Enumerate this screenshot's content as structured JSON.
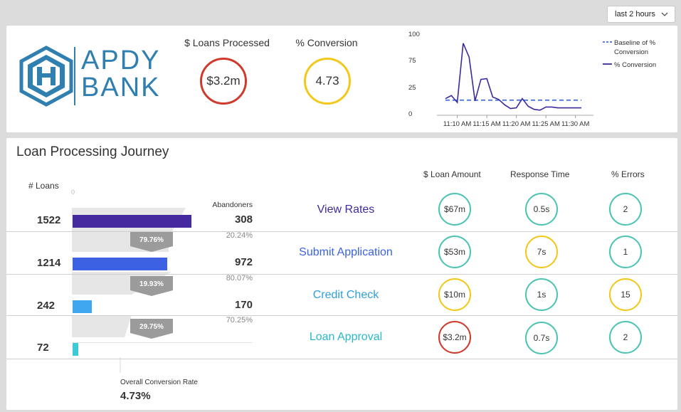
{
  "time_range": {
    "selected": "last 2 hours"
  },
  "logo": {
    "line1": "APDY",
    "line2": "BANK"
  },
  "kpis": {
    "loans_processed": {
      "label": "$ Loans Processed",
      "value": "$3.2m",
      "status": "#d03a2c"
    },
    "conversion": {
      "label": "% Conversion",
      "value": "4.73",
      "status": "#f2c81a"
    }
  },
  "chart_data": {
    "type": "line",
    "x": [
      "11:08",
      "11:09",
      "11:10",
      "11:11",
      "11:12",
      "11:13",
      "11:14",
      "11:15",
      "11:16",
      "11:17",
      "11:18",
      "11:19",
      "11:20",
      "11:21",
      "11:22",
      "11:23",
      "11:24",
      "11:25",
      "11:26",
      "11:27",
      "11:28",
      "11:29",
      "11:30",
      "11:31"
    ],
    "x_tick_labels": [
      "11:10 AM",
      "11:15 AM",
      "11:20 AM",
      "11:25 AM",
      "11:30 AM"
    ],
    "y_tick_labels": [
      "100",
      "75",
      "25",
      "0"
    ],
    "ylim": [
      0,
      100
    ],
    "series": [
      {
        "name": "% Conversion",
        "values": [
          18,
          22,
          13,
          90,
          72,
          15,
          43,
          44,
          20,
          17,
          10,
          5,
          6,
          18,
          8,
          4,
          3,
          7,
          7,
          6,
          6,
          6,
          6,
          6
        ],
        "style": "solid",
        "color": "#3b2a9c"
      },
      {
        "name": "Baseline of % Conversion",
        "values": [
          16,
          16,
          16,
          16,
          16,
          16,
          16,
          16,
          16,
          16,
          16,
          16,
          16,
          16,
          16,
          16,
          16,
          16,
          16,
          16,
          16,
          16,
          16,
          16
        ],
        "style": "dashed",
        "color": "#3f6fd8"
      }
    ],
    "legend": [
      "Baseline of % Conversion",
      "% Conversion"
    ],
    "legend_position": "right"
  },
  "journey": {
    "title": "Loan Processing Journey",
    "loans_header": "# Loans",
    "axis_zero": "0",
    "abandoners_header": "Abandoners",
    "col_amount": "$ Loan Amount",
    "col_response": "Response Time",
    "col_errors": "% Errors",
    "stages": [
      {
        "name": "View Rates",
        "name_color": "#3f2a9e",
        "loans": "1522",
        "loans_value": 1522,
        "bar_color": "#44299f",
        "abandoners": "308",
        "abandon_pct": "20.24%",
        "conversion": "79.76%",
        "amount": "$67m",
        "amount_status": "#4dc4b3",
        "response": "0.5s",
        "response_status": "#4dc4b3",
        "errors": "2",
        "errors_status": "#4dc4b3"
      },
      {
        "name": "Submit Application",
        "name_color": "#3b62e0",
        "loans": "1214",
        "loans_value": 1214,
        "bar_color": "#3d61e3",
        "abandoners": "972",
        "abandon_pct": "80.07%",
        "conversion": "19.93%",
        "amount": "$53m",
        "amount_status": "#4dc4b3",
        "response": "7s",
        "response_status": "#f2c81a",
        "errors": "1",
        "errors_status": "#4dc4b3"
      },
      {
        "name": "Credit Check",
        "name_color": "#2e9fe0",
        "loans": "242",
        "loans_value": 242,
        "bar_color": "#3fa6f0",
        "abandoners": "170",
        "abandon_pct": "70.25%",
        "conversion": "29.75%",
        "amount": "$10m",
        "amount_status": "#f2c81a",
        "response": "1s",
        "response_status": "#4dc4b3",
        "errors": "15",
        "errors_status": "#f2c81a"
      },
      {
        "name": "Loan Approval",
        "name_color": "#2ab8c8",
        "loans": "72",
        "loans_value": 72,
        "bar_color": "#3ccbd4",
        "abandoners": "",
        "abandon_pct": "",
        "conversion": "",
        "amount": "$3.2m",
        "amount_status": "#d03a2c",
        "response": "0.7s",
        "response_status": "#4dc4b3",
        "errors": "2",
        "errors_status": "#4dc4b3"
      }
    ],
    "overall": {
      "label": "Overall Conversion Rate",
      "value": "4.73%"
    }
  }
}
